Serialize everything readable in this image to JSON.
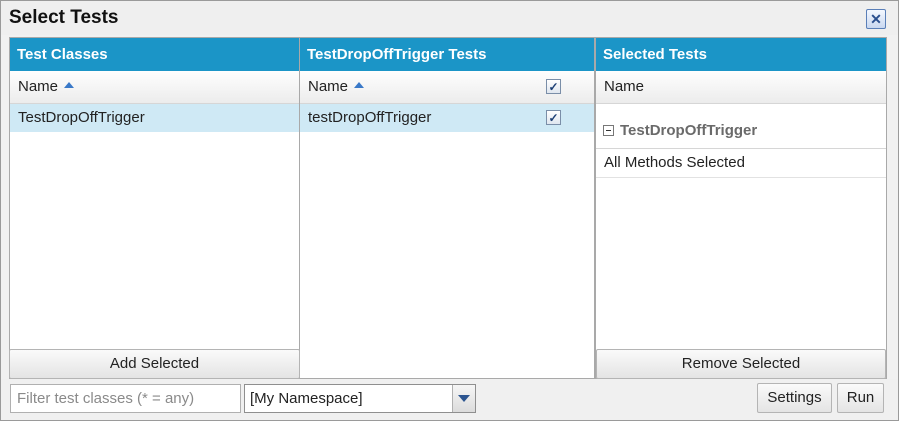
{
  "dialog": {
    "title": "Select Tests",
    "close_icon": "close-icon"
  },
  "panels": {
    "classes": {
      "header": "Test Classes",
      "column": "Name",
      "rows": [
        "TestDropOffTrigger"
      ],
      "button": "Add Selected"
    },
    "tests": {
      "header": "TestDropOffTrigger Tests",
      "column": "Name",
      "header_checked": true,
      "rows": [
        {
          "name": "testDropOffTrigger",
          "checked": true
        }
      ]
    },
    "selected": {
      "header": "Selected Tests",
      "column": "Name",
      "group": "TestDropOffTrigger",
      "items": [
        "All Methods Selected"
      ],
      "button": "Remove Selected"
    }
  },
  "footer": {
    "filter_placeholder": "Filter test classes (* = any)",
    "namespace": "[My Namespace]",
    "settings": "Settings",
    "run": "Run"
  },
  "colors": {
    "header_bg": "#1b95c7",
    "selected_row": "#cfe9f5"
  }
}
